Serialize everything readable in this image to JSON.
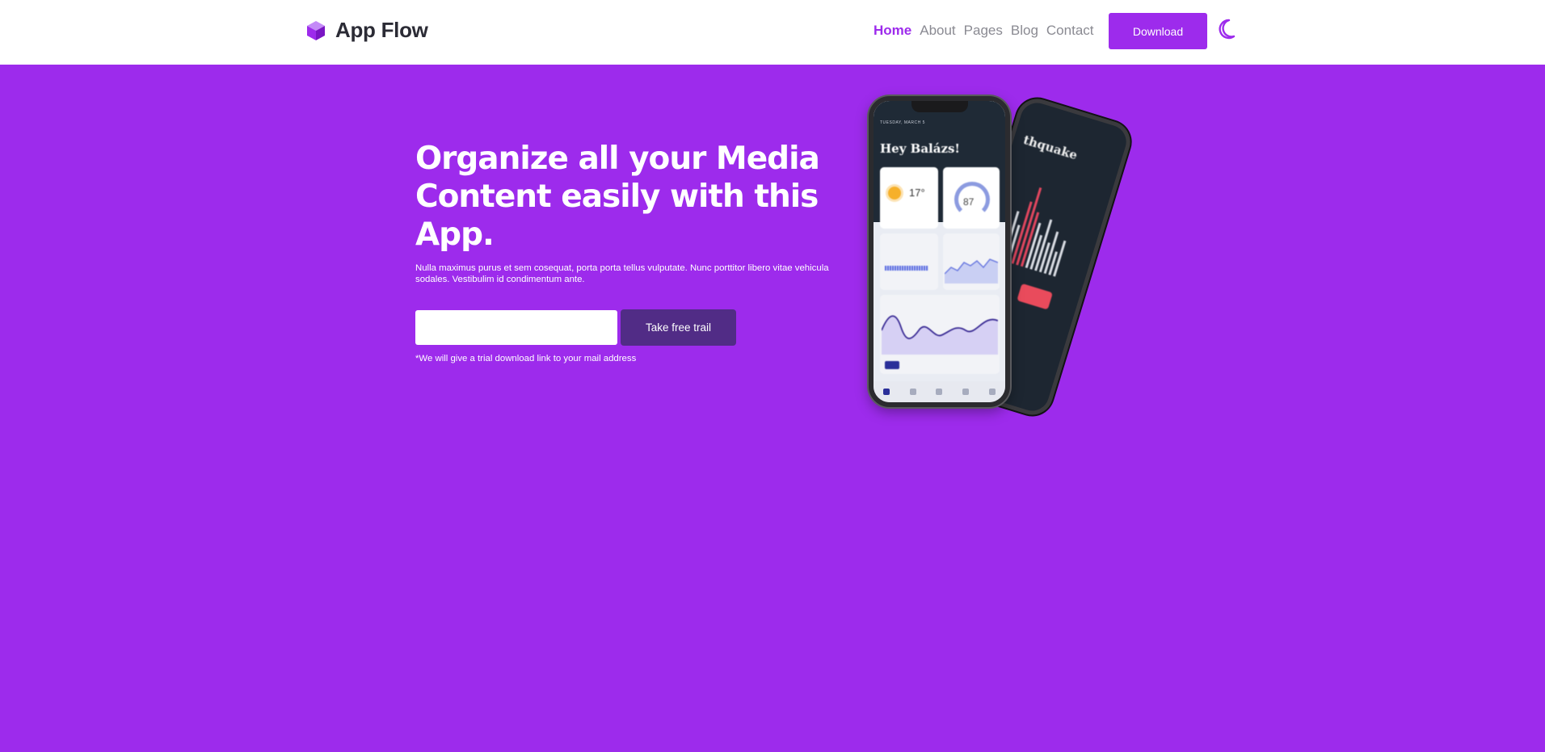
{
  "header": {
    "brand": "App Flow",
    "nav": [
      {
        "label": "Home",
        "active": true
      },
      {
        "label": "About",
        "active": false
      },
      {
        "label": "Pages",
        "active": false
      },
      {
        "label": "Blog",
        "active": false
      },
      {
        "label": "Contact",
        "active": false
      }
    ],
    "download_label": "Download",
    "theme_icon": "moon-icon",
    "logo_icon": "cube-icon"
  },
  "hero": {
    "title": "Organize all your Media Content easily with this App.",
    "description": "Nulla maximus purus et sem cosequat, porta porta tellus vulputate. Nunc porttitor libero vitae vehicula sodales. Vestibulim id condimentum ante.",
    "email_value": "",
    "cta_label": "Take free trail",
    "note": "*We will give a trial download link to your mail address"
  },
  "mockup": {
    "front_greeting": "Hey Balázs!",
    "front_date": "TUESDAY, MARCH 5",
    "front_temp": "17°",
    "front_air_quality": "87",
    "back_title": "thquake"
  },
  "colors": {
    "brand": "#9d2bec",
    "cta_dark": "#512c86",
    "text_dark": "#2b2b35",
    "nav_muted": "#8a8a92"
  }
}
